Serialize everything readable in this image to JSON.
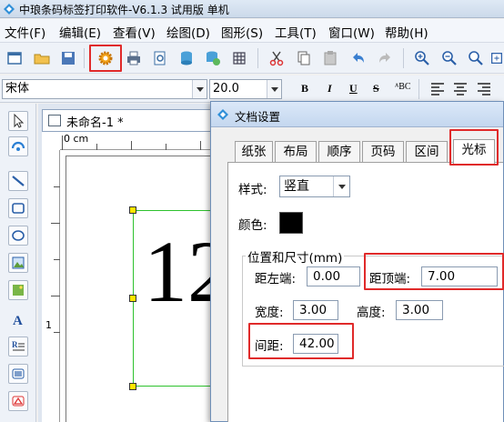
{
  "window": {
    "title": "中琅条码标签打印软件-V6.1.3 试用版 单机"
  },
  "menu": [
    "文件(F)",
    "编辑(E)",
    "查看(V)",
    "绘图(D)",
    "图形(S)",
    "工具(T)",
    "窗口(W)",
    "帮助(H)"
  ],
  "toolbar2": {
    "font": "宋体",
    "size": "20.0",
    "bold": "B",
    "italic": "I",
    "underline": "U",
    "strike": "S",
    "special": "ᴬBC"
  },
  "document": {
    "tab_name": "未命名-1 *",
    "ruler_label": "0 cm",
    "vruler_label": "1",
    "content_text": "12"
  },
  "dialog": {
    "title": "文档设置",
    "tabs": [
      "纸张",
      "布局",
      "顺序",
      "页码",
      "区间",
      "光标"
    ],
    "active_tab": "光标",
    "style_label": "样式:",
    "style_value": "竖直",
    "color_label": "颜色:",
    "color_value": "#000000",
    "group_label": "位置和尺寸(mm)",
    "left_label": "距左端:",
    "left_value": "0.00",
    "top_label": "距顶端:",
    "top_value": "7.00",
    "width_label": "宽度:",
    "width_value": "3.00",
    "height_label": "高度:",
    "height_value": "3.00",
    "spacing_label": "间距:",
    "spacing_value": "42.00"
  },
  "colors": {
    "highlight": "#e02a2a",
    "selection": "#2ec22e",
    "handle": "#ffe600"
  }
}
